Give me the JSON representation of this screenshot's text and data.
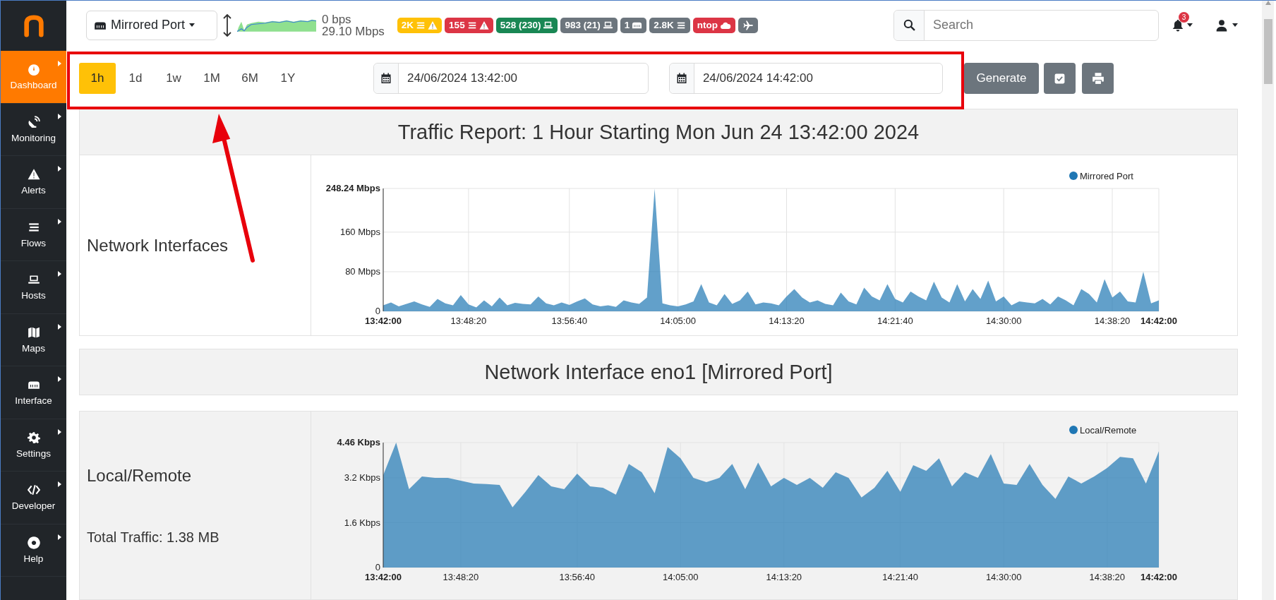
{
  "sidebar": {
    "items": [
      {
        "label": "Dashboard",
        "selected": true
      },
      {
        "label": "Monitoring",
        "selected": false
      },
      {
        "label": "Alerts",
        "selected": false
      },
      {
        "label": "Flows",
        "selected": false
      },
      {
        "label": "Hosts",
        "selected": false
      },
      {
        "label": "Maps",
        "selected": false
      },
      {
        "label": "Interface",
        "selected": false
      },
      {
        "label": "Settings",
        "selected": false
      },
      {
        "label": "Developer",
        "selected": false
      },
      {
        "label": "Help",
        "selected": false
      }
    ]
  },
  "topbar": {
    "interface": "Mirrored Port",
    "throughput": {
      "upload": "0 bps",
      "download": "29.10 Mbps"
    },
    "badges": [
      {
        "text": "2K",
        "kind": "flowalerts",
        "color": "#ffc107"
      },
      {
        "text": "155",
        "kind": "flowalerts",
        "color": "#dc3545"
      },
      {
        "text": "528 (230)",
        "kind": "hosts",
        "color": "#198754"
      },
      {
        "text": "983 (21)",
        "kind": "hosts",
        "color": "#6c757d"
      },
      {
        "text": "1",
        "kind": "devices",
        "color": "#6c757d"
      },
      {
        "text": "2.8K",
        "kind": "flows",
        "color": "#6c757d"
      },
      {
        "text": "ntop",
        "kind": "cloud",
        "color": "#dc3545"
      },
      {
        "kind": "remote",
        "color": "#6c757d"
      }
    ],
    "search": {
      "placeholder": "Search"
    },
    "notifications": "3"
  },
  "toolbar": {
    "ranges": [
      {
        "label": "1h",
        "selected": true
      },
      {
        "label": "1d",
        "selected": false
      },
      {
        "label": "1w",
        "selected": false
      },
      {
        "label": "1M",
        "selected": false
      },
      {
        "label": "6M",
        "selected": false
      },
      {
        "label": "1Y",
        "selected": false
      }
    ],
    "start": "24/06/2024 13:42:00",
    "end": "24/06/2024 14:42:00",
    "buttons": [
      {
        "kind": "generate",
        "label": "Generate"
      },
      {
        "kind": "check"
      },
      {
        "kind": "print"
      }
    ]
  },
  "report": {
    "blocks": [
      {
        "kind": "heading",
        "title": "Traffic Report: 1 Hour Starting Mon Jun 24 13:42:00 2024"
      },
      {
        "kind": "chart",
        "label": "Network Interfaces",
        "chart_data": {
          "type": "area",
          "grid": true,
          "ylim": [
            0,
            248.24
          ],
          "categories": [
            "13:42:00",
            null,
            null,
            null,
            null,
            null,
            null,
            null,
            null,
            null,
            null,
            "13:48:20",
            null,
            null,
            null,
            null,
            null,
            null,
            null,
            null,
            null,
            null,
            null,
            null,
            "13:56:40",
            null,
            null,
            null,
            null,
            null,
            null,
            null,
            null,
            null,
            null,
            null,
            null,
            null,
            "14:05:00",
            null,
            null,
            null,
            null,
            null,
            null,
            null,
            null,
            null,
            null,
            null,
            null,
            null,
            "14:13:20",
            null,
            null,
            null,
            null,
            null,
            null,
            null,
            null,
            null,
            null,
            null,
            null,
            null,
            "14:21:40",
            null,
            null,
            null,
            null,
            null,
            null,
            null,
            null,
            null,
            null,
            null,
            null,
            null,
            "14:30:00",
            null,
            null,
            null,
            null,
            null,
            null,
            null,
            null,
            null,
            null,
            null,
            null,
            null,
            "14:38:20",
            null,
            null,
            null,
            null,
            null,
            "14:42:00"
          ],
          "yticks": [
            {
              "value": 0,
              "label": "0"
            },
            {
              "value": 80,
              "label": "80 Mbps"
            },
            {
              "value": 160,
              "label": "160 Mbps"
            },
            {
              "value": 248.24,
              "label": "248.24 Mbps"
            }
          ],
          "series": [
            {
              "name": "Mirrored Port",
              "color": "#1f77b4",
              "values": [
                12,
                18,
                10,
                15,
                20,
                14,
                9,
                25,
                16,
                12,
                33,
                14,
                8,
                22,
                10,
                28,
                12,
                17,
                15,
                14,
                30,
                16,
                12,
                18,
                13,
                20,
                26,
                14,
                10,
                12,
                9,
                22,
                18,
                15,
                28,
                248,
                16,
                12,
                10,
                14,
                20,
                55,
                18,
                12,
                35,
                15,
                22,
                40,
                14,
                18,
                16,
                12,
                30,
                45,
                28,
                18,
                22,
                15,
                12,
                38,
                20,
                14,
                48,
                30,
                22,
                55,
                25,
                18,
                40,
                30,
                22,
                60,
                28,
                18,
                55,
                20,
                45,
                25,
                62,
                20,
                30,
                12,
                20,
                18,
                16,
                25,
                14,
                30,
                22,
                12,
                45,
                35,
                18,
                65,
                28,
                40,
                20,
                18,
                80,
                16,
                22
              ]
            }
          ]
        }
      },
      {
        "kind": "heading",
        "title": "Network Interface eno1 [Mirrored Port]"
      },
      {
        "kind": "chart",
        "label": "Local/Remote",
        "note": "Total Traffic: 1.38 MB",
        "chart_data": {
          "type": "area",
          "grid": true,
          "ylim": [
            0,
            4.46
          ],
          "categories": [
            "13:42:00",
            null,
            null,
            null,
            null,
            null,
            "13:48:20",
            null,
            null,
            null,
            null,
            null,
            null,
            null,
            null,
            "13:56:40",
            null,
            null,
            null,
            null,
            null,
            null,
            null,
            "14:05:00",
            null,
            null,
            null,
            null,
            null,
            null,
            null,
            "14:13:20",
            null,
            null,
            null,
            null,
            null,
            null,
            null,
            null,
            "14:21:40",
            null,
            null,
            null,
            null,
            null,
            null,
            null,
            "14:30:00",
            null,
            null,
            null,
            null,
            null,
            null,
            null,
            "14:38:20",
            null,
            null,
            null,
            "14:42:00"
          ],
          "yticks": [
            {
              "value": 0,
              "label": "0"
            },
            {
              "value": 1.6,
              "label": "1.6 Kbps"
            },
            {
              "value": 3.2,
              "label": "3.2 Kbps"
            },
            {
              "value": 4.46,
              "label": "4.46 Kbps"
            }
          ],
          "series": [
            {
              "name": "Local/Remote",
              "color": "#1f77b4",
              "values": [
                3.3,
                4.46,
                2.8,
                3.25,
                3.2,
                3.2,
                3.1,
                3.0,
                2.98,
                2.95,
                2.15,
                2.7,
                3.3,
                2.9,
                2.8,
                3.35,
                2.9,
                2.85,
                2.6,
                3.7,
                3.4,
                2.65,
                4.3,
                3.9,
                3.2,
                3.05,
                3.2,
                3.7,
                2.8,
                3.75,
                2.9,
                3.2,
                2.95,
                3.2,
                2.85,
                3.4,
                3.2,
                2.5,
                2.85,
                3.45,
                2.7,
                3.65,
                3.45,
                3.9,
                2.9,
                3.4,
                3.2,
                4.05,
                3.0,
                2.95,
                3.7,
                2.95,
                2.45,
                3.25,
                3.0,
                3.25,
                3.55,
                3.95,
                3.9,
                3.0,
                4.15
              ]
            }
          ]
        }
      }
    ]
  },
  "annotations": [
    {
      "kind": "box"
    },
    {
      "kind": "arrow"
    }
  ]
}
